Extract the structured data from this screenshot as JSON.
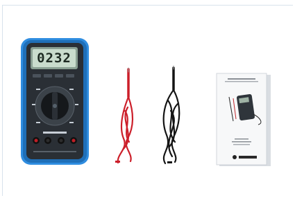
{
  "display": {
    "reading": "0232"
  },
  "meter": {
    "brand_text": "",
    "footer_text": ""
  },
  "manual": {
    "title": "",
    "model": "",
    "brand": ""
  },
  "colors": {
    "meter_blue": "#2f8de0",
    "meter_body": "#2a2f35",
    "lcd": "#c9dccd",
    "red_lead": "#cc1f2a",
    "black_lead": "#141414"
  }
}
